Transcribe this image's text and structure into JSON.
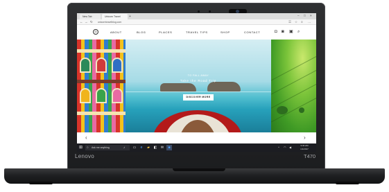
{
  "device": {
    "brand": "Lenovo",
    "model": "T470"
  },
  "browser": {
    "tabs": [
      {
        "label": "New Tab",
        "active": false
      },
      {
        "label": "Unicorn Travel Blog",
        "active": true
      }
    ],
    "new_tab_glyph": "+",
    "url": "unicorntravelblog.com"
  },
  "site": {
    "logo_icon": "compass-icon",
    "nav": [
      "ABOUT",
      "BLOG",
      "PLACES",
      "TRAVEL TIPS",
      "SHOP",
      "CONTACT"
    ],
    "header_icons": [
      "instagram-icon",
      "facebook-icon",
      "pinterest-icon",
      "search-icon"
    ],
    "hero": {
      "kicker": "TO FALL AWAY",
      "title": "Take the Road Trip",
      "cta": "DISCOVER MORE"
    },
    "carousel": {
      "prev": "‹",
      "next": "›"
    }
  },
  "taskbar": {
    "search_placeholder": "Ask me anything",
    "pinned_icons": [
      "task-view-icon",
      "edge-icon",
      "file-explorer-icon",
      "store-icon",
      "mail-icon",
      "app-icon"
    ],
    "clock_time": "9:30 AM",
    "clock_date": "1/1/2017"
  },
  "colors": {
    "bezel": "#1c1d1f",
    "taskbar": "#1c1d22",
    "sea": "#27a1bb",
    "boat": "#b31a1a",
    "field": "#7bc43a"
  }
}
